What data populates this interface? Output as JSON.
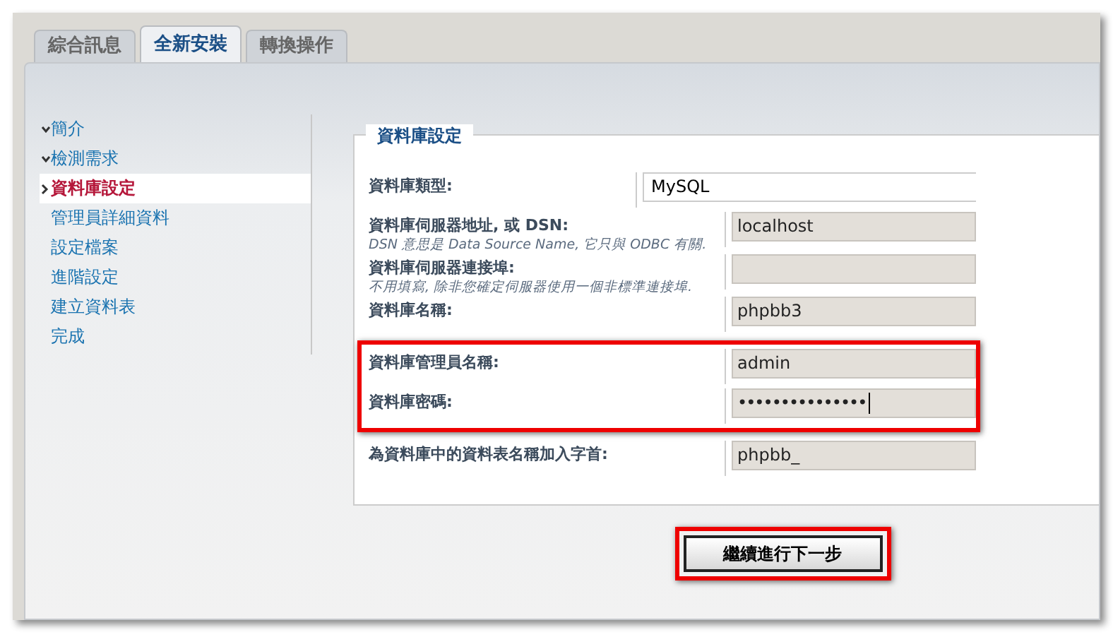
{
  "tabs": [
    {
      "label": "綜合訊息",
      "selected": false
    },
    {
      "label": "全新安裝",
      "selected": true
    },
    {
      "label": "轉換操作",
      "selected": false
    }
  ],
  "sidebar": {
    "items": [
      {
        "label": "簡介",
        "done": true,
        "selected": false
      },
      {
        "label": "檢測需求",
        "done": true,
        "selected": false
      },
      {
        "label": "資料庫設定",
        "done": false,
        "selected": true
      },
      {
        "label": "管理員詳細資料",
        "done": false,
        "selected": false
      },
      {
        "label": "設定檔案",
        "done": false,
        "selected": false
      },
      {
        "label": "進階設定",
        "done": false,
        "selected": false
      },
      {
        "label": "建立資料表",
        "done": false,
        "selected": false
      },
      {
        "label": "完成",
        "done": false,
        "selected": false
      }
    ]
  },
  "form": {
    "legend": "資料庫設定",
    "fields": [
      {
        "label": "資料庫類型:",
        "kind": "select",
        "value": "MySQL",
        "highlighted": false
      },
      {
        "label": "資料庫伺服器地址, 或 DSN:",
        "hint": "DSN 意思是 Data Source Name, 它只與 ODBC 有關.",
        "kind": "text",
        "value": "localhost",
        "highlighted": false
      },
      {
        "label": "資料庫伺服器連接埠:",
        "hint": "不用填寫, 除非您確定伺服器使用一個非標準連接埠.",
        "kind": "text",
        "highlighted": false
      },
      {
        "label": "資料庫名稱:",
        "kind": "text",
        "value": "phpbb3",
        "highlighted": false
      },
      {
        "label": "資料庫管理員名稱:",
        "kind": "text",
        "value": "admin",
        "highlighted": true
      },
      {
        "label": "資料庫密碼:",
        "kind": "password",
        "value": "•••••••••••••••",
        "highlighted": true
      },
      {
        "label": "為資料庫中的資料表名稱加入字首:",
        "kind": "text",
        "value": "phpbb_",
        "highlighted": false
      }
    ]
  },
  "submit": {
    "label": "繼續進行下一步",
    "highlighted": true
  }
}
